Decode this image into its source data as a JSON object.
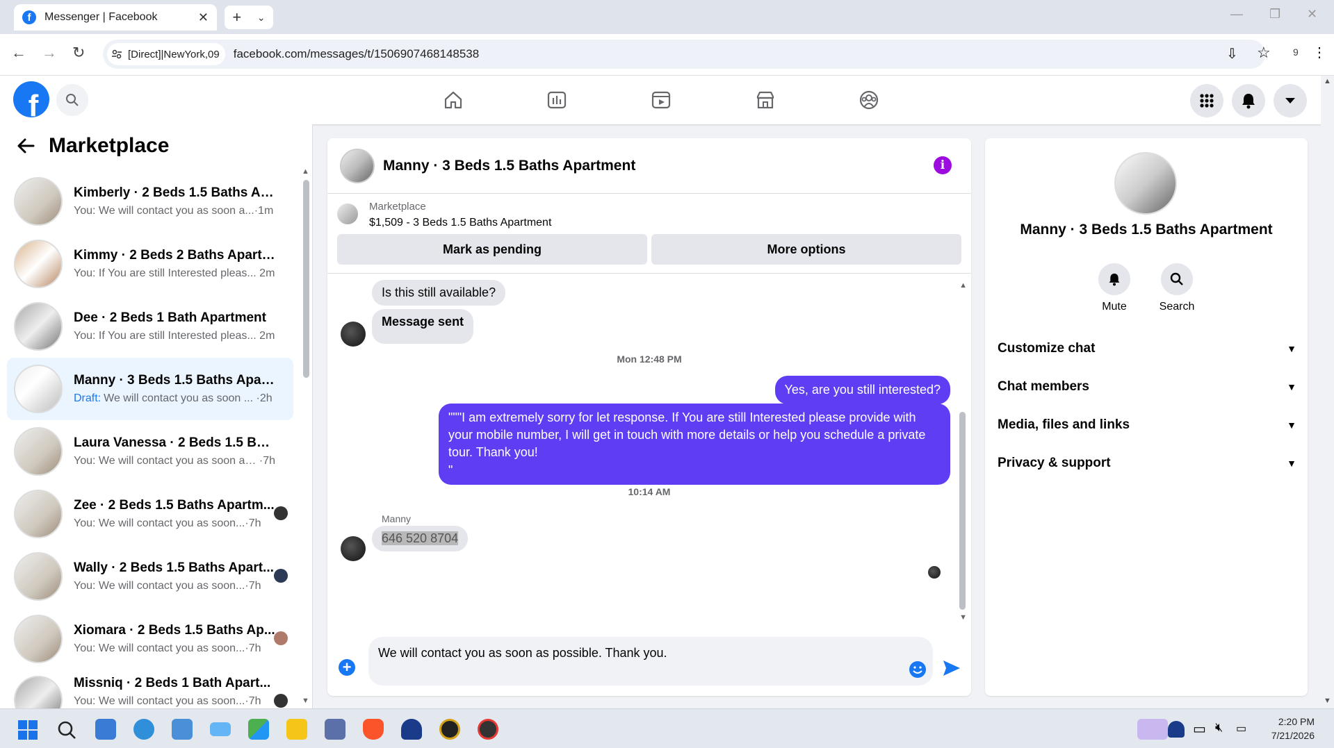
{
  "browser": {
    "tab_title": "Messenger | Facebook",
    "site_chip": "[Direct]|NewYork,09",
    "url": "facebook.com/messages/t/1506907468148538",
    "ext_count": "9"
  },
  "sidebar": {
    "title": "Marketplace",
    "conversations": [
      {
        "name": "Kimberly · 2 Beds 1.5 Baths Apar...",
        "prefix": "You:",
        "preview": "We will contact you as soon a...",
        "time": "·1m",
        "active": false
      },
      {
        "name": "Kimmy · 2 Beds 2 Baths Apartm...",
        "prefix": "You:",
        "preview": "If You are still Interested pleas...",
        "time": "2m",
        "active": false
      },
      {
        "name": "Dee · 2 Beds 1 Bath Apartment",
        "prefix": "You:",
        "preview": "If You are still Interested pleas...",
        "time": "2m",
        "active": false
      },
      {
        "name": "Manny · 3 Beds 1.5 Baths Apart...",
        "prefix": "Draft:",
        "preview": "We will contact you as soon ...",
        "time": "·2h",
        "active": true
      },
      {
        "name": "Laura Vanessa · 2 Beds 1.5 Baths ...",
        "prefix": "You:",
        "preview": "We will contact you as soon as...",
        "time": "·7h",
        "active": false
      },
      {
        "name": "Zee · 2 Beds 1.5 Baths Apartm...",
        "prefix": "You:",
        "preview": "We will contact you as soon...",
        "time": "·7h",
        "active": false
      },
      {
        "name": "Wally · 2 Beds 1.5 Baths Apart...",
        "prefix": "You:",
        "preview": "We will contact you as soon...",
        "time": "·7h",
        "active": false
      },
      {
        "name": "Xiomara · 2 Beds 1.5 Baths Ap...",
        "prefix": "You:",
        "preview": "We will contact you as soon...",
        "time": "·7h",
        "active": false
      },
      {
        "name": "Missniq · 2 Beds 1 Bath Apart...",
        "prefix": "You:",
        "preview": "We will contact you as soon...",
        "time": "·7h",
        "active": false
      }
    ]
  },
  "chat": {
    "title": "Manny · 3 Beds 1.5 Baths Apartment",
    "listing_source": "Marketplace",
    "listing_title": "$1,509 - 3 Beds 1.5 Baths Apartment",
    "btn_pending": "Mark as pending",
    "btn_more": "More options",
    "msg1": "Is this still available?",
    "msg2": "Message sent",
    "ts1": "Mon 12:48 PM",
    "out1": "Yes, are you still interested?",
    "out2": "\"\"\"I am extremely sorry for let response. If You are still Interested please provide with your mobile number, I will get in touch with more details or help you schedule a private tour. Thank you!\n\"",
    "ts2": "10:14 AM",
    "sender": "Manny",
    "msg3": "646 520 8704",
    "draft": "We will contact you as soon as possible. Thank you."
  },
  "info": {
    "title": "Manny · 3 Beds 1.5 Baths Apartment",
    "mute": "Mute",
    "search": "Search",
    "sections": [
      "Customize chat",
      "Chat members",
      "Media, files and links",
      "Privacy & support"
    ]
  },
  "taskbar": {
    "time": "2:20 PM",
    "date": "7/21/2026"
  },
  "colors": {
    "fb_blue": "#1877f2",
    "outgoing_bubble": "#5f3df2",
    "info_icon": "#9d0cdf"
  }
}
